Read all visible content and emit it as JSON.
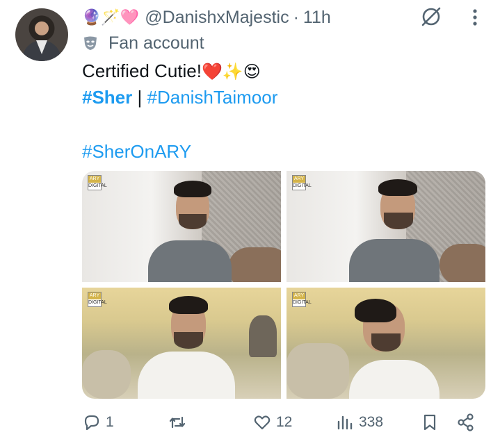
{
  "tweet": {
    "author_emojis": "🔮🪄🩷",
    "handle": "@DanishxMajestic",
    "separator": "·",
    "time": "11h",
    "account_label": "Fan account",
    "text": "Certified Cutie!",
    "text_emojis": "❤️✨😍",
    "hashtags_line1": [
      "#Sher",
      "#DanishTaimoor"
    ],
    "hashtag_divider": "|",
    "hashtag_line2": "#SherOnARY",
    "media_logo": "ARY",
    "media_logo_sub": "DIGITAL"
  },
  "actions": {
    "reply_count": "1",
    "retweet_count": "",
    "like_count": "12",
    "views_count": "338"
  },
  "icons": [
    "avatar",
    "grok-icon",
    "more-icon",
    "mask-icon",
    "reply-icon",
    "retweet-icon",
    "like-icon",
    "views-icon",
    "bookmark-icon",
    "share-icon"
  ],
  "colors": {
    "hashtag": "#1d9bf0",
    "muted": "#536471",
    "text": "#0f1419"
  }
}
